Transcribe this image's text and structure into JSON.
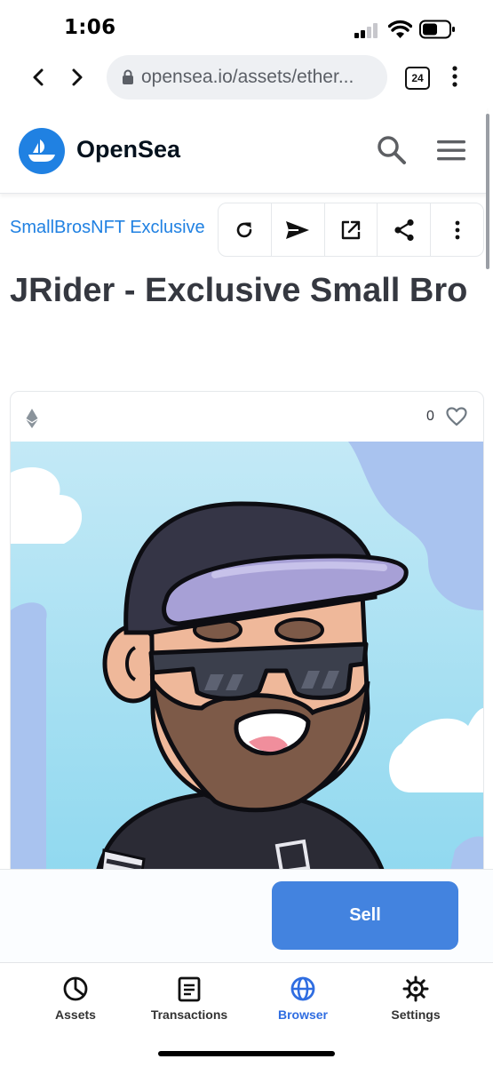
{
  "status_bar": {
    "time": "1:06"
  },
  "browser": {
    "url": "opensea.io/assets/ether...",
    "tab_count": "24"
  },
  "site": {
    "name": "OpenSea"
  },
  "asset": {
    "collection": "SmallBrosNFT Exclusive",
    "title": "JRider - Exclusive Small Bro",
    "favorites": "0"
  },
  "actions": {
    "sell_label": "Sell"
  },
  "bottom_nav": {
    "tabs": [
      {
        "label": "Assets",
        "icon": "pie-chart-icon"
      },
      {
        "label": "Transactions",
        "icon": "document-icon"
      },
      {
        "label": "Browser",
        "icon": "globe-icon",
        "active": true
      },
      {
        "label": "Settings",
        "icon": "gear-icon"
      }
    ]
  },
  "colors": {
    "brand_blue": "#2081e2",
    "sell_button": "#4383df",
    "title_text": "#353840",
    "active_tab": "#2f6de1"
  }
}
